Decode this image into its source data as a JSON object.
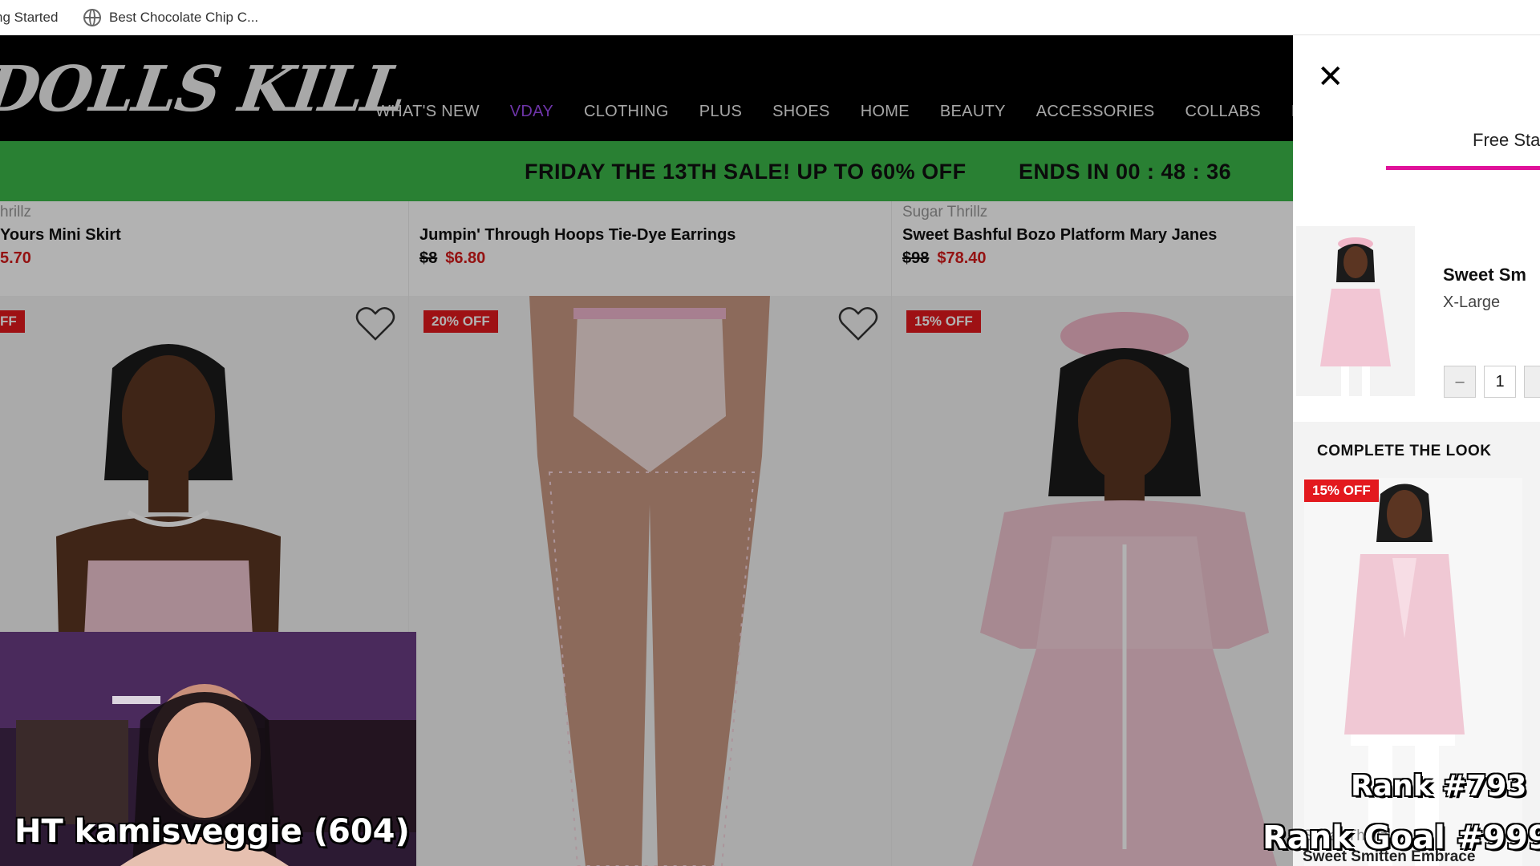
{
  "bookmarks": [
    {
      "label": "ng Started"
    },
    {
      "label": "Best Chocolate Chip C..."
    }
  ],
  "site": {
    "logo_text": "DOLLS KILL",
    "nav": [
      "WHAT'S NEW",
      "VDAY",
      "CLOTHING",
      "PLUS",
      "SHOES",
      "HOME",
      "BEAUTY",
      "ACCESSORIES",
      "COLLABS",
      "BR"
    ],
    "active_nav": "VDAY",
    "promo": {
      "text": "FRIDAY THE 13TH SALE! UP TO 60% OFF",
      "timer": "ENDS IN 00 : 48 : 36",
      "color": "#3bb84a"
    },
    "products": [
      {
        "brand": "hrillz",
        "name": "Yours Mini Skirt",
        "price_was": "",
        "price_now": "5.70",
        "badge": "FF"
      },
      {
        "brand": "",
        "name": "Jumpin' Through Hoops Tie-Dye Earrings",
        "price_was": "$8",
        "price_now": "$6.80",
        "badge": "20% OFF"
      },
      {
        "brand": "Sugar Thrillz",
        "name": "Sweet Bashful Bozo Platform Mary Janes",
        "price_was": "$98",
        "price_now": "$78.40",
        "badge": "15% OFF"
      }
    ]
  },
  "drawer": {
    "close_icon": "close-icon",
    "shipping_text": "Free Sta",
    "cart_item": {
      "name": "Sweet Sm",
      "size": "X-Large",
      "qty_minus": "–",
      "quantity": "1"
    },
    "complete_look": {
      "title": "COMPLETE THE LOOK",
      "badge": "15% OFF",
      "brand": "Sugar Thrillz",
      "name": "Sweet Smitten Embrace"
    },
    "accent": "#e0129a"
  },
  "stream": {
    "webcam_caption": "HT kamisveggie (604)",
    "rank": "Rank #793",
    "rank_goal": "Rank Goal #999"
  }
}
